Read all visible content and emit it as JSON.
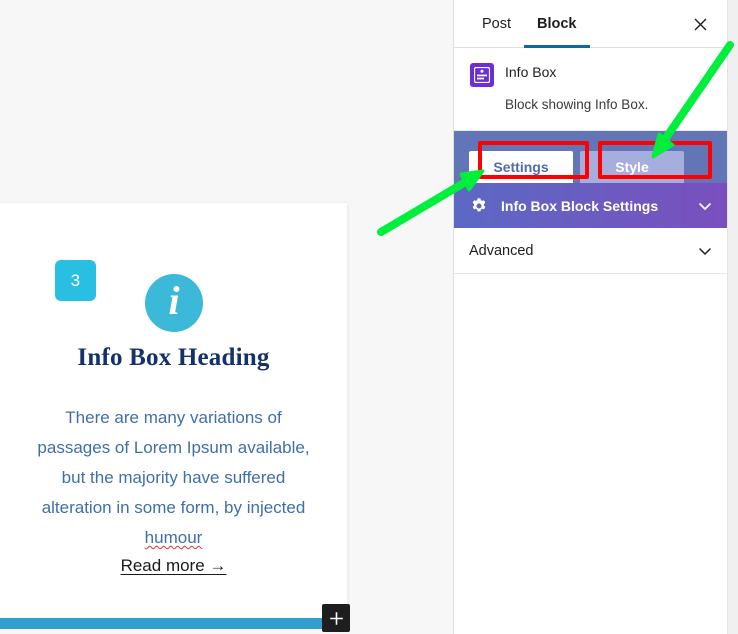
{
  "editor": {
    "card": {
      "badge_number": "3",
      "icon_name": "info-circle-icon",
      "icon_glyph": "i",
      "heading": "Info Box Heading",
      "body_text": "There are many variations of passages of Lorem Ipsum available, but the majority have suffered alteration in some form, by injected ",
      "body_misspelled_word": "humour",
      "read_more_label": "Read more →"
    },
    "add_block_label": "+"
  },
  "sidebar": {
    "tabs": [
      {
        "label": "Post",
        "active": false
      },
      {
        "label": "Block",
        "active": true
      }
    ],
    "close_label": "×",
    "block": {
      "title": "Info Box",
      "description": "Block showing Info Box."
    },
    "toggle_buttons": [
      {
        "label": "Settings",
        "active": true
      },
      {
        "label": "Style",
        "active": false
      }
    ],
    "section": {
      "label": "Info Box Block Settings",
      "expanded": false
    },
    "advanced": {
      "label": "Advanced",
      "expanded": false
    }
  },
  "colors": {
    "accent_cyan": "#29bfe3",
    "icon_cyan": "#3cb9d9",
    "heading_navy": "#13326b",
    "body_blue": "#3f6fab",
    "tab_underline": "#0a6a9e",
    "toggle_bar": "#6275b6",
    "section_gradient_from": "#5b69c4",
    "section_gradient_to": "#7a4fbd",
    "block_icon_purple": "#6b2fd4",
    "bottom_bar_blue": "#309fd0",
    "annotation_red": "#ff0000",
    "annotation_green": "#00ef3c",
    "canvas_bg": "#f7f7f7"
  }
}
